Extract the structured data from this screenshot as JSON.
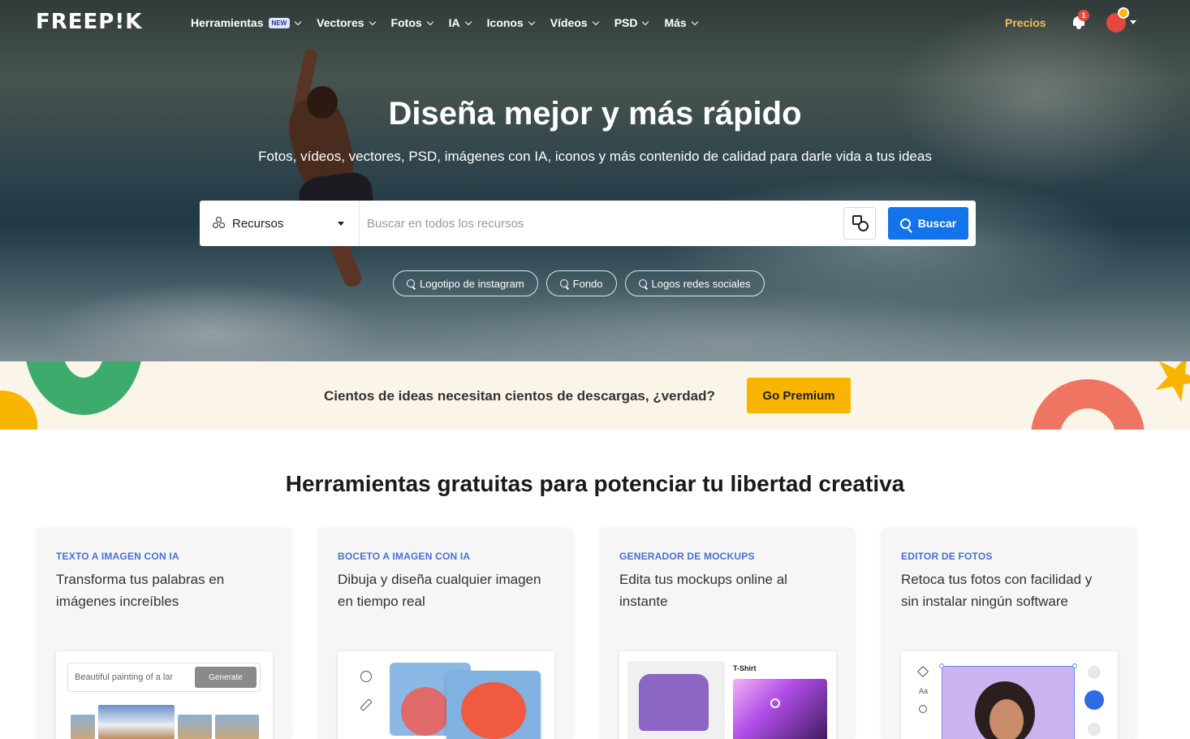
{
  "nav": {
    "logo": "FREEP!K",
    "items": [
      {
        "label": "Herramientas",
        "badge": "NEW"
      },
      {
        "label": "Vectores"
      },
      {
        "label": "Fotos"
      },
      {
        "label": "IA"
      },
      {
        "label": "Iconos"
      },
      {
        "label": "Vídeos"
      },
      {
        "label": "PSD"
      },
      {
        "label": "Más"
      }
    ],
    "pricing": "Precios",
    "notifications_count": "1"
  },
  "hero": {
    "title": "Diseña mejor y más rápido",
    "subtitle": "Fotos, vídeos, vectores, PSD, imágenes con IA, iconos y más contenido de calidad para darle vida a tus ideas"
  },
  "search": {
    "type_label": "Recursos",
    "placeholder": "Buscar en todos los recursos",
    "button_label": "Buscar",
    "suggestions": [
      "Logotipo de instagram",
      "Fondo",
      "Logos redes sociales"
    ]
  },
  "promo": {
    "text": "Cientos de ideas necesitan cientos de descargas, ¿verdad?",
    "button_label": "Go Premium"
  },
  "tools": {
    "title": "Herramientas gratuitas para potenciar tu libertad creativa",
    "cards": [
      {
        "kicker": "TEXTO A IMAGEN CON IA",
        "description": "Transforma tus palabras en imágenes increíbles",
        "preview_prompt": "Beautiful painting of a lar",
        "preview_button": "Generate"
      },
      {
        "kicker": "BOCETO A IMAGEN CON IA",
        "description": "Dibuja y diseña cualquier imagen en tiempo real"
      },
      {
        "kicker": "GENERADOR DE MOCKUPS",
        "description": "Edita tus mockups online al instante",
        "preview_label": "T-Shirt"
      },
      {
        "kicker": "EDITOR DE FOTOS",
        "description": "Retoca tus fotos con facilidad y sin instalar ningún software",
        "preview_tool": "Aa"
      }
    ]
  },
  "colors": {
    "primary_blue": "#1273eb",
    "premium_yellow": "#f7b500",
    "pricing_yellow": "#f2c14e",
    "kicker_blue": "#4a6fdb"
  }
}
